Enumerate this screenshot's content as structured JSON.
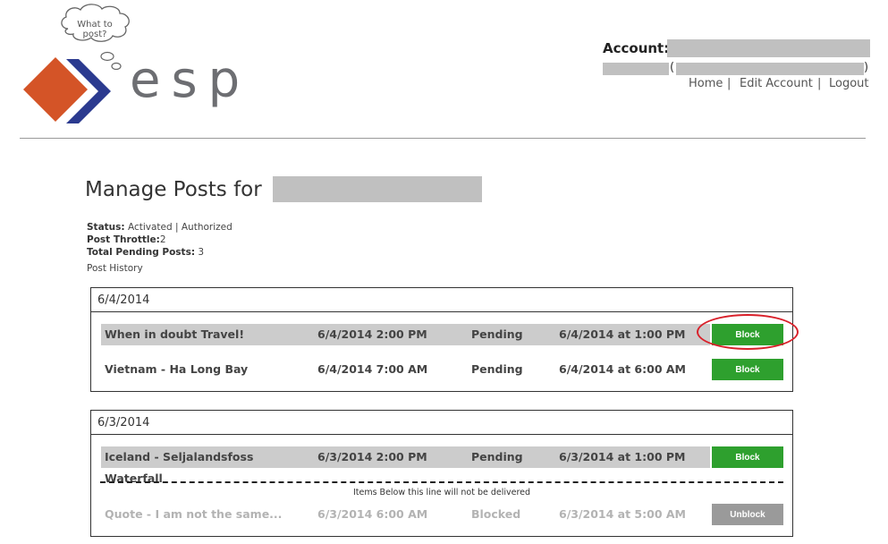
{
  "brand": {
    "cloud_text": "What to post?",
    "wordmark": "esp",
    "colors": {
      "orange": "#d45427",
      "navy": "#2b3a8f",
      "gray": "#6d6e72"
    }
  },
  "account": {
    "label": "Account:",
    "open_paren": "(",
    "close_paren": ")"
  },
  "nav": {
    "home": "Home",
    "edit_account": "Edit Account",
    "logout": "Logout",
    "separator": "|"
  },
  "page": {
    "title": "Manage Posts for",
    "status_label": "Status:",
    "status_value": "Activated | Authorized",
    "throttle_label": "Post Throttle:",
    "throttle_value": "2",
    "pending_label": "Total Pending Posts:",
    "pending_value": "3",
    "history_label": "Post History"
  },
  "groups": [
    {
      "date": "6/4/2014",
      "rows": [
        {
          "title": "When in doubt Travel!",
          "scheduled": "6/4/2014 2:00 PM",
          "status": "Pending",
          "created": "6/4/2014 at 1:00 PM",
          "action": "Block"
        },
        {
          "title": "Vietnam - Ha Long Bay",
          "scheduled": "6/4/2014 7:00 AM",
          "status": "Pending",
          "created": "6/4/2014 at 6:00 AM",
          "action": "Block"
        }
      ]
    },
    {
      "date": "6/3/2014",
      "rows": [
        {
          "title": "Iceland - Seljalandsfoss Waterfall",
          "scheduled": "6/3/2014 2:00 PM",
          "status": "Pending",
          "created": "6/3/2014 at 1:00 PM",
          "action": "Block"
        }
      ],
      "divider_note": "Items Below this line will not be delivered",
      "blocked_rows": [
        {
          "title": "Quote - I am not the same...",
          "scheduled": "6/3/2014 6:00 AM",
          "status": "Blocked",
          "created": "6/3/2014 at 5:00 AM",
          "action": "Unblock"
        }
      ]
    }
  ]
}
